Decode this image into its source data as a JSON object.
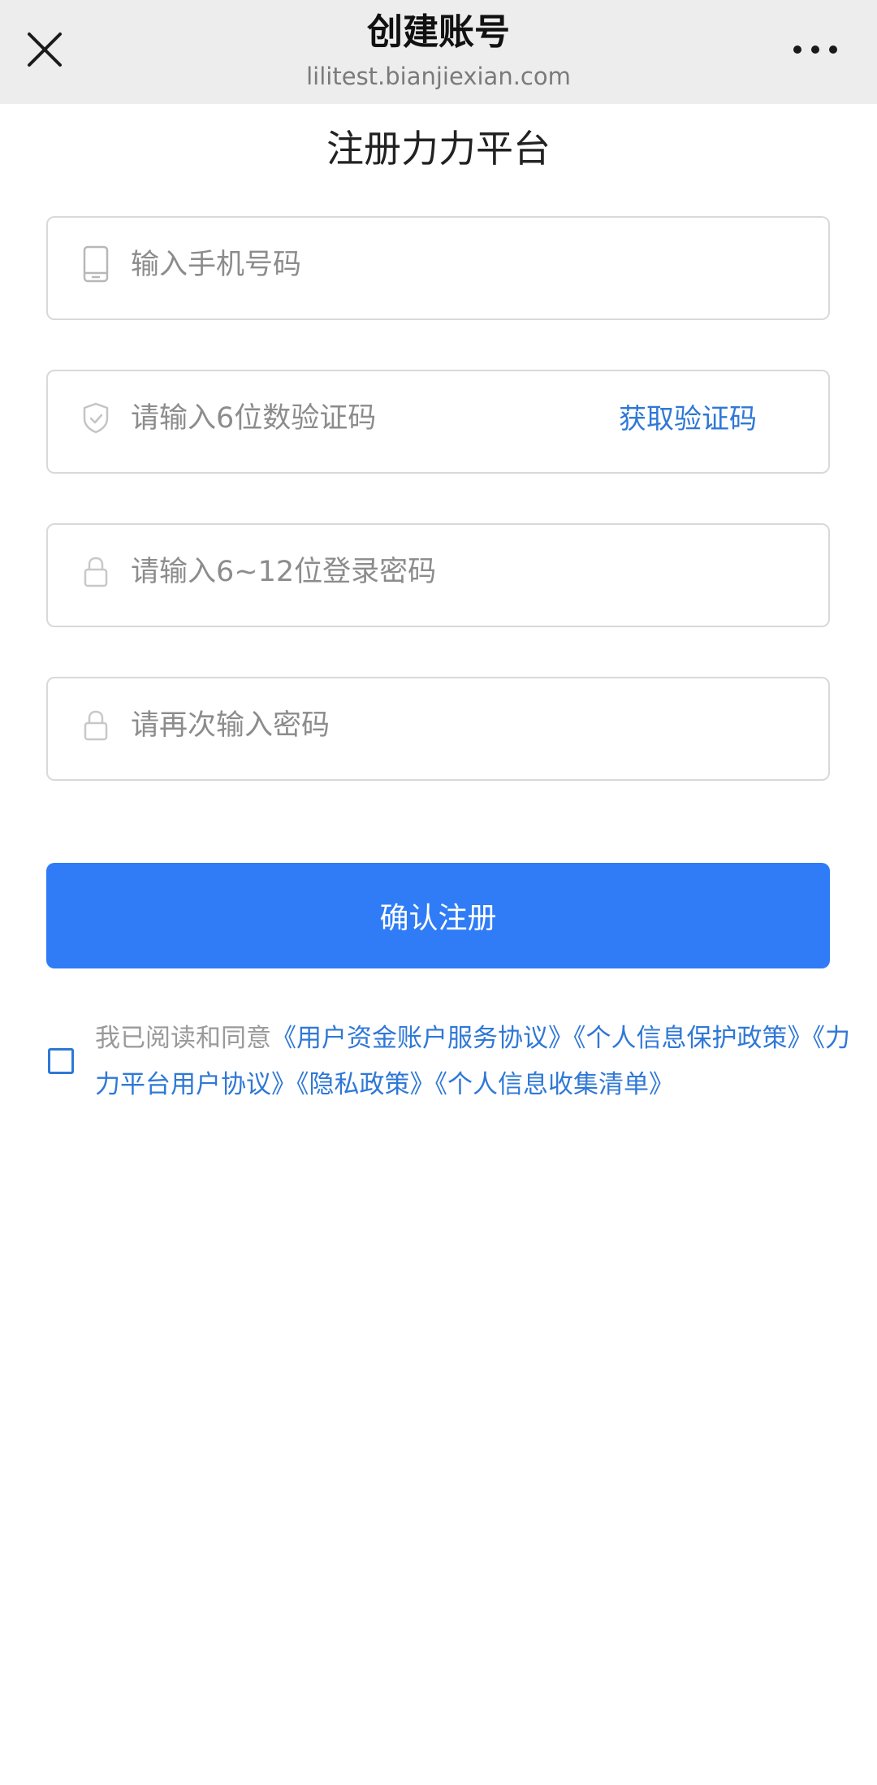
{
  "nav": {
    "title": "创建账号",
    "url": "lilitest.bianjiexian.com"
  },
  "page": {
    "title": "注册力力平台"
  },
  "form": {
    "phone_placeholder": "输入手机号码",
    "code_placeholder": "请输入6位数验证码",
    "get_code_label": "获取验证码",
    "password_placeholder": "请输入6~12位登录密码",
    "confirm_placeholder": "请再次输入密码",
    "submit_label": "确认注册"
  },
  "agreement": {
    "prefix": "我已阅读和同意",
    "links": [
      "《用户资金账户服务协议》",
      "《个人信息保护政策》",
      "《力力平台用户协议》",
      "《隐私政策》",
      "《个人信息收集清单》"
    ]
  },
  "colors": {
    "accent": "#2f7cf6",
    "link": "#2f78d6",
    "topbar": "#ededed"
  },
  "icons": [
    "close-icon",
    "more-icon",
    "phone-icon",
    "shield-icon",
    "lock-icon"
  ]
}
